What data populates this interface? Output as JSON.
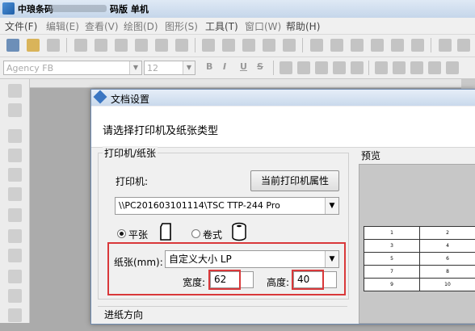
{
  "app": {
    "title_prefix": "中琅条码",
    "title_suffix": "码版 单机"
  },
  "menu": [
    "文件(F)",
    "编辑(E)",
    "查看(V)",
    "绘图(D)",
    "图形(S)",
    "工具(T)",
    "窗口(W)",
    "帮助(H)"
  ],
  "format_bar": {
    "font_name": "Agency FB",
    "font_size": "12",
    "bold": "B",
    "italic": "I",
    "underline": "U",
    "strike": "S"
  },
  "dialog": {
    "title": "文档设置",
    "header_text": "请选择打印机及纸张类型",
    "printer_group_label": "打印机/纸张",
    "printer_label": "打印机:",
    "printer_props_button": "当前打印机属性",
    "printer_value": "\\\\PC201603101114\\TSC TTP-244 Pro",
    "paper_flat_label": "平张",
    "paper_roll_label": "卷式",
    "paper_label": "纸张(mm):",
    "paper_value": "自定义大小 LP",
    "width_label": "宽度:",
    "width_value": "62",
    "height_label": "高度:",
    "height_value": "40",
    "preview_label": "预览",
    "feed_direction_label": "进纸方向"
  },
  "preview_table": [
    [
      "1",
      "2"
    ],
    [
      "3",
      "4"
    ],
    [
      "5",
      "6"
    ],
    [
      "7",
      "8"
    ],
    [
      "9",
      "10"
    ]
  ],
  "colors": {
    "highlight": "#d9383a",
    "title_bar": "#c9d9ec"
  }
}
